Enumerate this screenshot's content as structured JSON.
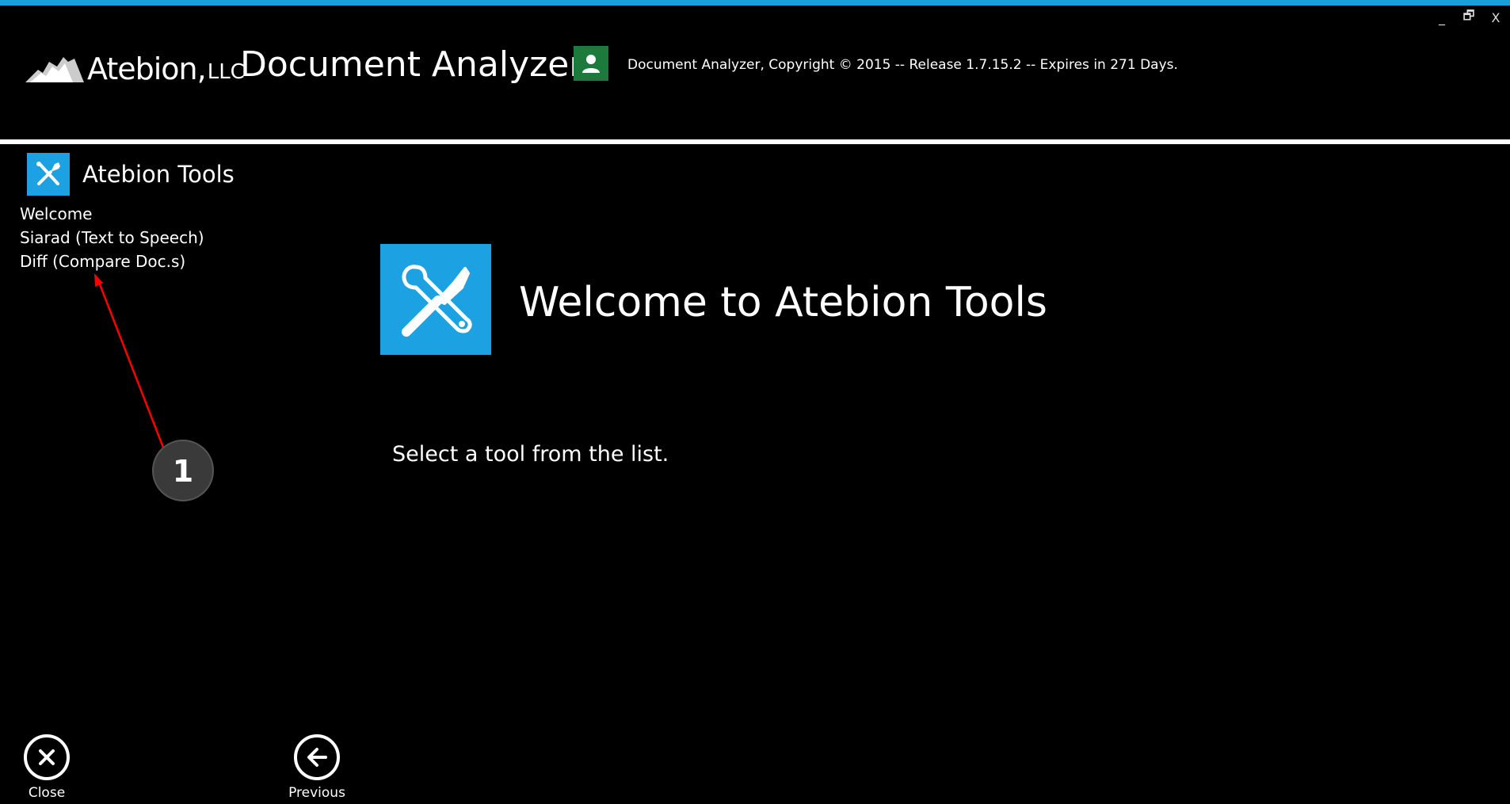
{
  "window": {
    "controls": {
      "minimize": "_",
      "restore": "🗗",
      "close": "X"
    }
  },
  "header": {
    "logo_text": "Atebion,",
    "logo_suffix": "LLC",
    "app_title": "Document Analyzer",
    "copyright": "Document Analyzer, Copyright © 2015 -- Release 1.7.15.2 -- Expires in 271 Days.",
    "user_badge_icon": "user-icon"
  },
  "sidebar": {
    "title": "Atebion Tools",
    "icon": "tools-icon",
    "items": [
      {
        "label": "Welcome"
      },
      {
        "label": "Siarad (Text to Speech)"
      },
      {
        "label": "Diff (Compare Doc.s)"
      }
    ]
  },
  "main": {
    "title": "Welcome to Atebion Tools",
    "subtitle": "Select a tool from the list.",
    "icon": "tools-icon"
  },
  "annotation": {
    "number": "1",
    "color": "#ff0000"
  },
  "footer": {
    "close_label": "Close",
    "previous_label": "Previous"
  },
  "colors": {
    "accent": "#19a0d8",
    "tile": "#1ca1e2",
    "badge": "#1b7a3c",
    "background": "#000000"
  }
}
